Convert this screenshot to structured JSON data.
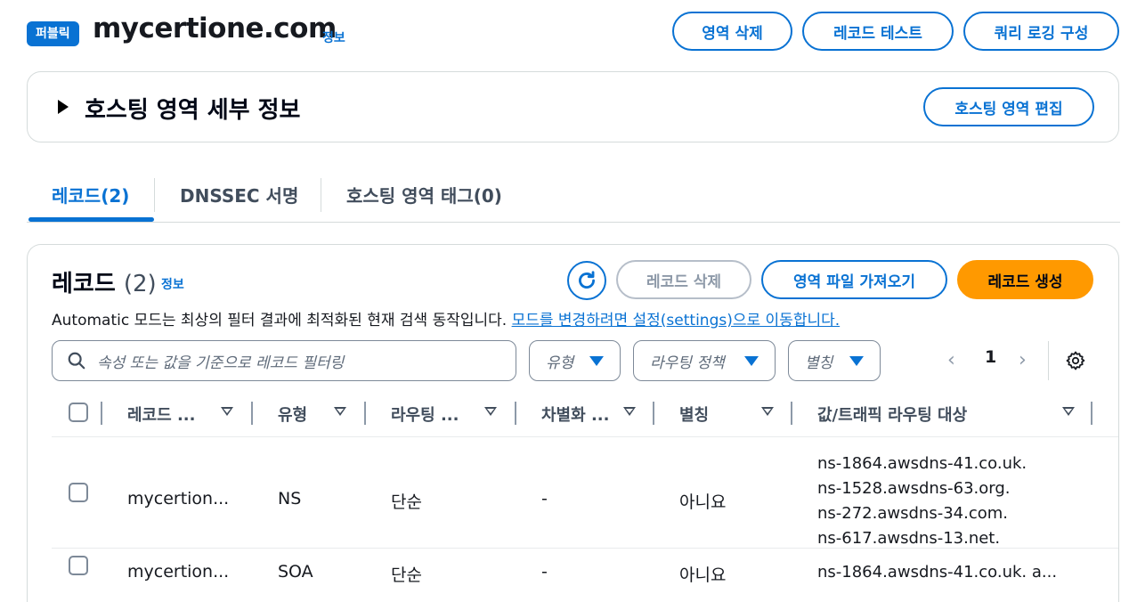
{
  "header": {
    "badge": "퍼블릭",
    "title": "mycertione.com",
    "info_label": "정보",
    "buttons": [
      "영역 삭제",
      "레코드 테스트",
      "쿼리 로깅 구성"
    ]
  },
  "details": {
    "title": "호스팅 영역 세부 정보",
    "edit_button": "호스팅 영역 편집"
  },
  "tabs": [
    {
      "label": "레코드(2)",
      "active": true
    },
    {
      "label": "DNSSEC 서명",
      "active": false
    },
    {
      "label": "호스팅 영역 태그(0)",
      "active": false
    }
  ],
  "records": {
    "title": "레코드",
    "count": "(2)",
    "info_label": "정보",
    "description": "Automatic 모드는 최상의 필터 결과에 최적화된 현재 검색 동작입니다.",
    "description_link": "모드를 변경하려면 설정(settings)으로 이동합니다.",
    "delete_button": "레코드 삭제",
    "import_button": "영역 파일 가져오기",
    "create_button": "레코드 생성",
    "search_placeholder": "속성 또는 값을 기준으로 레코드 필터링",
    "filters": [
      "유형",
      "라우팅 정책",
      "별칭"
    ],
    "page": "1"
  },
  "table": {
    "columns": [
      "레코드 ...",
      "유형",
      "라우팅 ...",
      "차별화 ...",
      "별칭",
      "값/트래픽 라우팅 대상"
    ],
    "rows": [
      {
        "name": "mycertion...",
        "type": "NS",
        "routing": "단순",
        "diff": "-",
        "alias": "아니요",
        "values": [
          "ns-1864.awsdns-41.co.uk.",
          "ns-1528.awsdns-63.org.",
          "ns-272.awsdns-34.com.",
          "ns-617.awsdns-13.net."
        ]
      },
      {
        "name": "mycertion...",
        "type": "SOA",
        "routing": "단순",
        "diff": "-",
        "alias": "아니요",
        "values": [
          "ns-1864.awsdns-41.co.uk. a..."
        ]
      }
    ]
  },
  "colors": {
    "accent": "#0972d3",
    "primary_button": "#ff9900",
    "badge": "#0972d3"
  }
}
